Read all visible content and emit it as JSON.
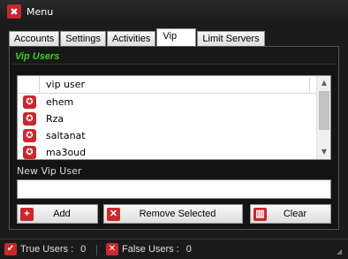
{
  "window": {
    "title": "Menu"
  },
  "tabs": [
    {
      "label": "Accounts",
      "active": false
    },
    {
      "label": "Settings",
      "active": false
    },
    {
      "label": "Activities",
      "active": false
    },
    {
      "label": "Vip",
      "active": true
    },
    {
      "label": "Limit Servers",
      "active": false
    }
  ],
  "vip_panel": {
    "header": "Vip Users",
    "header_color": "#39d11f",
    "list": {
      "column_header": "vip user",
      "items": [
        "ehem",
        "Rza",
        "saltanat",
        "ma3oud"
      ]
    },
    "new_user_label": "New Vip User",
    "new_user_value": ""
  },
  "buttons": {
    "add": "Add",
    "remove_selected": "Remove Selected",
    "clear": "Clear"
  },
  "status": {
    "true_users_label": "True Users :",
    "true_users_count": "0",
    "false_users_label": "False Users :",
    "false_users_count": "0"
  },
  "colors": {
    "accent": "#c8282e",
    "header_green": "#39d11f"
  },
  "icons": {
    "app": "tools-icon",
    "row": "star-icon",
    "add": "plus-icon",
    "remove": "x-icon",
    "clear": "trash-icon"
  }
}
